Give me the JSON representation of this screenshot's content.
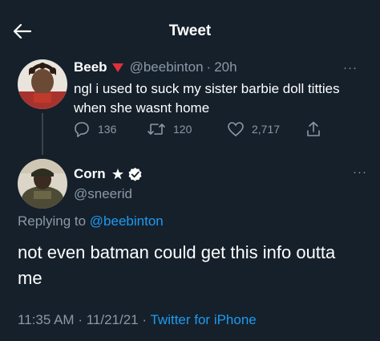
{
  "header": {
    "title": "Tweet",
    "back_icon": "arrow-left-icon"
  },
  "parent_tweet": {
    "display_name": "Beeb",
    "emoji": "red-triangle",
    "handle": "@beebinton",
    "separator": "·",
    "time": "20h",
    "text": "ngl i used to suck my sister barbie doll titties when she wasnt home",
    "more": "···",
    "actions": {
      "replies": "136",
      "retweets": "120",
      "likes": "2,717"
    }
  },
  "main_tweet": {
    "display_name": "Corn",
    "handle": "@sneerid",
    "more": "···",
    "replying_prefix": "Replying to",
    "replying_to": "@beebinton",
    "text": "not even batman could get this info outta me",
    "time": "11:35 AM",
    "sep1": "·",
    "date": "11/21/21",
    "sep2": "·",
    "source": "Twitter for iPhone"
  },
  "colors": {
    "background": "#15202b",
    "muted": "#8b98a5",
    "link": "#1d9bf0",
    "text": "#ffffff"
  }
}
